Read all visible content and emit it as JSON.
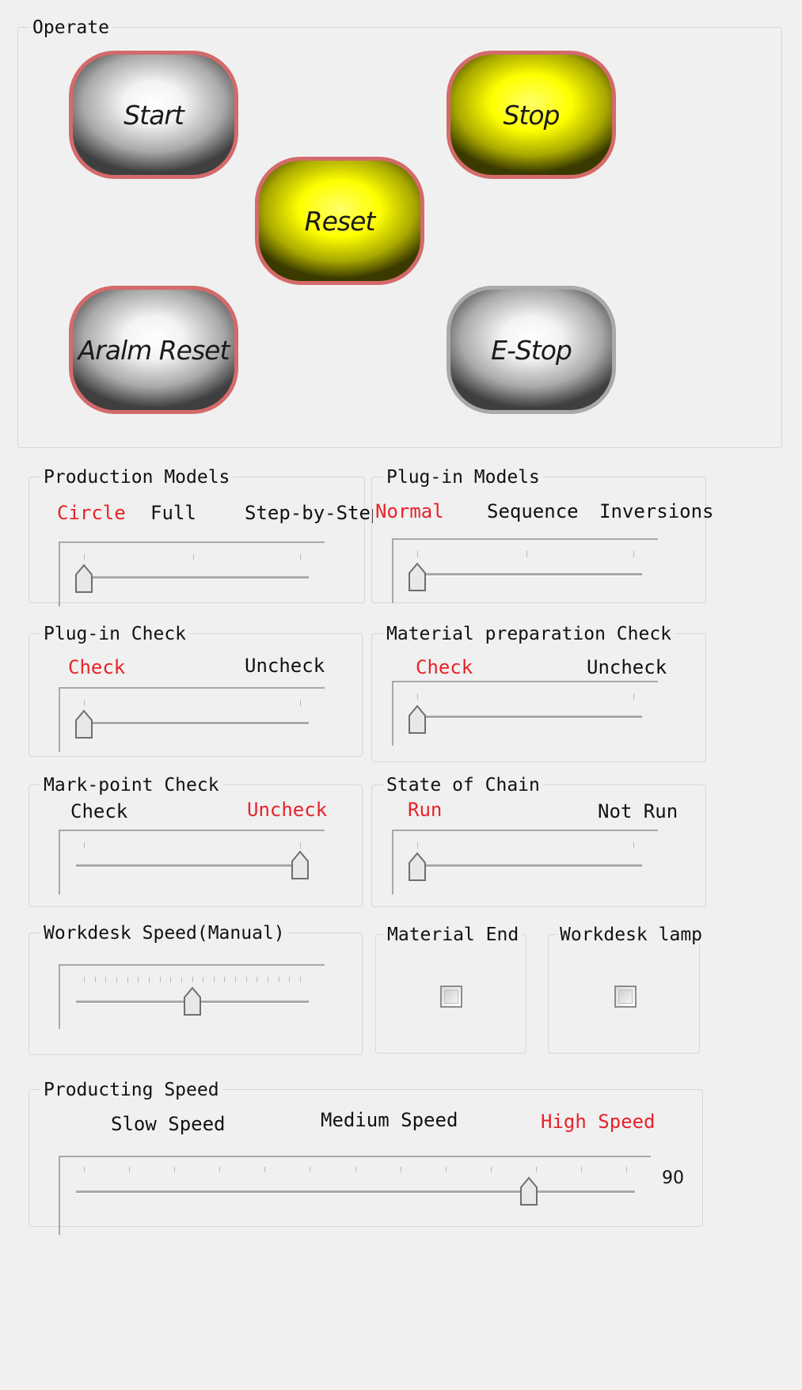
{
  "operate": {
    "legend": "Operate",
    "start": "Start",
    "stop": "Stop",
    "reset": "Reset",
    "alarm_reset": "Aralm Reset",
    "estop": "E-Stop"
  },
  "production_models": {
    "legend": "Production Models",
    "options": [
      "Circle",
      "Full",
      "Step-by-Step"
    ],
    "selected_index": 0
  },
  "plugin_models": {
    "legend": "Plug-in Models",
    "options": [
      "Normal",
      "Sequence",
      "Inversions"
    ],
    "selected_index": 0
  },
  "plugin_check": {
    "legend": "Plug-in Check",
    "options": [
      "Check",
      "Uncheck"
    ],
    "selected_index": 0
  },
  "material_prep_check": {
    "legend": "Material preparation Check",
    "options": [
      "Check",
      "Uncheck"
    ],
    "selected_index": 0
  },
  "markpoint_check": {
    "legend": "Mark-point Check",
    "options": [
      "Check",
      "Uncheck"
    ],
    "selected_index": 1
  },
  "state_of_chain": {
    "legend": "State of Chain",
    "options": [
      "Run",
      "Not Run"
    ],
    "selected_index": 0
  },
  "workdesk_speed": {
    "legend": "Workdesk Speed(Manual)",
    "level": 0.5
  },
  "material_end": {
    "legend": "Material End",
    "checked": false
  },
  "workdesk_lamp": {
    "legend": "Workdesk lamp",
    "checked": false
  },
  "producing_speed": {
    "legend": "Producting Speed",
    "options": [
      "Slow Speed",
      "Medium Speed",
      "High Speed"
    ],
    "selected_index": 2,
    "value": "90",
    "level": 0.82
  },
  "colors": {
    "selected_text": "#e8222a",
    "button_yellow": "#ffff00",
    "button_border": "#d46a6a"
  }
}
